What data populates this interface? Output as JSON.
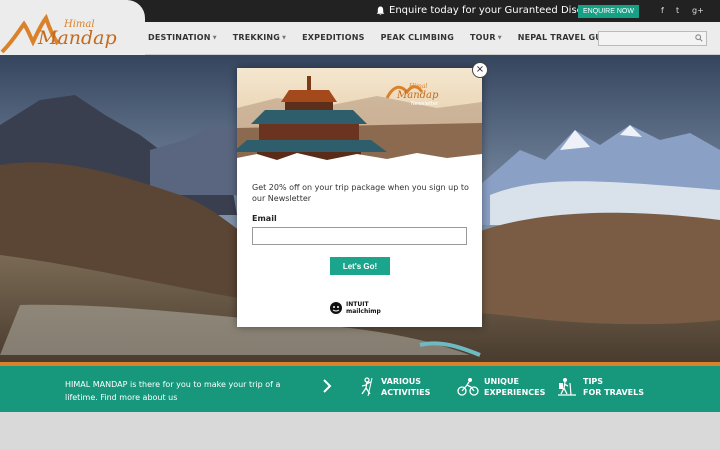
{
  "topbar": {
    "message": "Enquire today for your Guranteed Discount.",
    "enquire_label": "ENQUIRE NOW",
    "social": [
      "f",
      "t",
      "g+"
    ]
  },
  "logo": {
    "line1": "Himal",
    "line2": "Mandap"
  },
  "nav": {
    "items": [
      {
        "label": "DESTINATION",
        "dropdown": true
      },
      {
        "label": "TREKKING",
        "dropdown": true
      },
      {
        "label": "EXPEDITIONS",
        "dropdown": false
      },
      {
        "label": "PEAK CLIMBING",
        "dropdown": false
      },
      {
        "label": "TOUR",
        "dropdown": true
      },
      {
        "label": "NEPAL TRAVEL GUIDE",
        "dropdown": false
      }
    ],
    "search_placeholder": ""
  },
  "band": {
    "text": "HIMAL MANDAP is there for you to make your trip of a lifetime. Find more about us",
    "features": [
      {
        "label": "VARIOUS\nACTIVITIES",
        "icon": "climber-icon"
      },
      {
        "label": "UNIQUE\nEXPERIENCES",
        "icon": "cyclist-icon"
      },
      {
        "label": "TIPS\nFOR TRAVELS",
        "icon": "hiker-icon"
      }
    ]
  },
  "modal": {
    "header_logo_line1": "Himal",
    "header_logo_line2": "Mandap",
    "header_logo_sub": "Newsletter",
    "text": "Get 20% off on your trip package when you sign up to our Newsletter",
    "email_label": "Email",
    "email_value": "",
    "submit_label": "Let's Go!",
    "mailchimp_line1": "INTUIT",
    "mailchimp_line2": "mailchimp",
    "close": "×"
  },
  "colors": {
    "accent_green": "#17977b",
    "accent_orange": "#d9822b",
    "topbar": "#222222"
  }
}
